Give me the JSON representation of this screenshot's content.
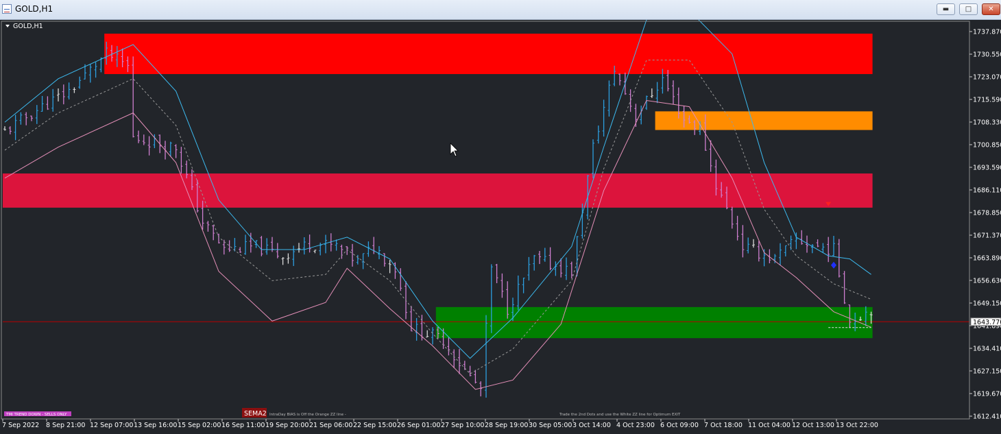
{
  "window": {
    "title": "GOLD,H1",
    "min_label": "▬",
    "max_label": "□",
    "close_label": "✕"
  },
  "chart_label": "GOLD,H1",
  "current_price_label": "1643.770",
  "sema_label": "SEMA2",
  "notes": {
    "trend": "TMI TREND DOWN - SELLS ONLY",
    "bias": "IntraDay BIAS is Off the Orange ZZ line -",
    "exit": "Trade the 2nd Dots and use the White ZZ line for Optimum EXIT"
  },
  "colors": {
    "background": "#22252a",
    "bull_bar": "#2d9fe0",
    "bear_bar": "#cf7fd0",
    "neutral_bar": "#d8d8d8",
    "supply_zone": "#ff0000",
    "resistance_zone": "#dc143c",
    "orange_zone": "#ff8c00",
    "demand_zone": "#008000",
    "upper_band": "#3cb9ee",
    "lower_band": "#e48fb8",
    "mid_line": "#999999",
    "price_line": "#b80000"
  },
  "chart_data": {
    "type": "candlestick",
    "symbol": "GOLD",
    "timeframe": "H1",
    "ylim": [
      1612.5,
      1740.5
    ],
    "y_ticks": [
      "1737.870",
      "1730.550",
      "1723.070",
      "1715.590",
      "1708.330",
      "1700.850",
      "1693.590",
      "1686.110",
      "1678.850",
      "1671.370",
      "1663.890",
      "1656.630",
      "1649.150",
      "1641.890",
      "1634.410",
      "1627.150",
      "1619.670",
      "1612.410"
    ],
    "x_labels": [
      "7 Sep 2022",
      "8 Sep 21:00",
      "12 Sep 07:00",
      "13 Sep 16:00",
      "15 Sep 02:00",
      "16 Sep 11:00",
      "19 Sep 20:00",
      "21 Sep 06:00",
      "22 Sep 15:00",
      "26 Sep 01:00",
      "27 Sep 10:00",
      "28 Sep 19:00",
      "30 Sep 05:00",
      "3 Oct 14:00",
      "4 Oct 23:00",
      "6 Oct 09:00",
      "7 Oct 18:00",
      "11 Oct 04:00",
      "12 Oct 13:00",
      "13 Oct 22:00"
    ],
    "current_price": 1643.77,
    "zones": [
      {
        "kind": "supply",
        "color": "#ff0000",
        "from": 1723.5,
        "to": 1736.5,
        "start_bar": 19
      },
      {
        "kind": "resistance",
        "color": "#dc143c",
        "from": 1680.5,
        "to": 1691.5,
        "start_bar": 0
      },
      {
        "kind": "orange",
        "color": "#ff8c00",
        "from": 1705.5,
        "to": 1711.5,
        "start_bar": 122
      },
      {
        "kind": "demand",
        "color": "#008000",
        "from": 1638.5,
        "to": 1648.5,
        "start_bar": 81
      }
    ],
    "anchors": [
      [
        0,
        1705
      ],
      [
        6,
        1712
      ],
      [
        12,
        1718
      ],
      [
        19,
        1730
      ],
      [
        23,
        1726
      ],
      [
        24,
        1703
      ],
      [
        32,
        1700
      ],
      [
        37,
        1676
      ],
      [
        41,
        1667
      ],
      [
        47,
        1668
      ],
      [
        52,
        1665
      ],
      [
        57,
        1669
      ],
      [
        62,
        1668
      ],
      [
        66,
        1663
      ],
      [
        69,
        1668
      ],
      [
        73,
        1661
      ],
      [
        76,
        1642
      ],
      [
        82,
        1638
      ],
      [
        86,
        1628
      ],
      [
        89,
        1622
      ],
      [
        91,
        1661
      ],
      [
        94,
        1648
      ],
      [
        99,
        1664
      ],
      [
        106,
        1660
      ],
      [
        110,
        1700
      ],
      [
        114,
        1725
      ],
      [
        118,
        1710
      ],
      [
        123,
        1722
      ],
      [
        127,
        1709
      ],
      [
        130,
        1706
      ],
      [
        133,
        1688
      ],
      [
        138,
        1668
      ],
      [
        144,
        1664
      ],
      [
        148,
        1670
      ],
      [
        152,
        1668
      ],
      [
        155,
        1667
      ],
      [
        158,
        1644
      ],
      [
        162,
        1648
      ]
    ],
    "upper_band": [
      [
        0,
        1708
      ],
      [
        10,
        1722
      ],
      [
        24,
        1733
      ],
      [
        32,
        1718
      ],
      [
        40,
        1683
      ],
      [
        48,
        1667
      ],
      [
        56,
        1667
      ],
      [
        64,
        1671
      ],
      [
        72,
        1664
      ],
      [
        80,
        1644
      ],
      [
        87,
        1632
      ],
      [
        95,
        1645
      ],
      [
        106,
        1668
      ],
      [
        112,
        1700
      ],
      [
        120,
        1741
      ],
      [
        128,
        1744
      ],
      [
        136,
        1730
      ],
      [
        142,
        1695
      ],
      [
        148,
        1671
      ],
      [
        154,
        1665
      ],
      [
        158,
        1664
      ],
      [
        162,
        1659
      ]
    ],
    "lower_band": [
      [
        0,
        1690
      ],
      [
        10,
        1700
      ],
      [
        24,
        1711
      ],
      [
        32,
        1695
      ],
      [
        40,
        1660
      ],
      [
        50,
        1644
      ],
      [
        60,
        1650
      ],
      [
        64,
        1661
      ],
      [
        72,
        1648
      ],
      [
        80,
        1636
      ],
      [
        88,
        1622
      ],
      [
        95,
        1625
      ],
      [
        104,
        1643
      ],
      [
        112,
        1686
      ],
      [
        120,
        1715
      ],
      [
        128,
        1713
      ],
      [
        136,
        1690
      ],
      [
        142,
        1666
      ],
      [
        148,
        1658
      ],
      [
        155,
        1647
      ],
      [
        162,
        1642
      ]
    ],
    "mid_line": [
      [
        0,
        1699
      ],
      [
        10,
        1711
      ],
      [
        24,
        1722
      ],
      [
        32,
        1707
      ],
      [
        40,
        1671
      ],
      [
        50,
        1657
      ],
      [
        60,
        1659
      ],
      [
        64,
        1667
      ],
      [
        72,
        1657
      ],
      [
        80,
        1640
      ],
      [
        87,
        1627
      ],
      [
        95,
        1635
      ],
      [
        106,
        1657
      ],
      [
        112,
        1693
      ],
      [
        120,
        1728
      ],
      [
        128,
        1728
      ],
      [
        136,
        1708
      ],
      [
        142,
        1680
      ],
      [
        148,
        1665
      ],
      [
        155,
        1656
      ],
      [
        162,
        1651
      ]
    ],
    "markers": [
      {
        "type": "arrow-down",
        "color": "#ff2020",
        "bar": 154,
        "price": 1681
      },
      {
        "type": "dot",
        "color": "#2030ff",
        "bar": 155,
        "price": 1662
      }
    ]
  }
}
